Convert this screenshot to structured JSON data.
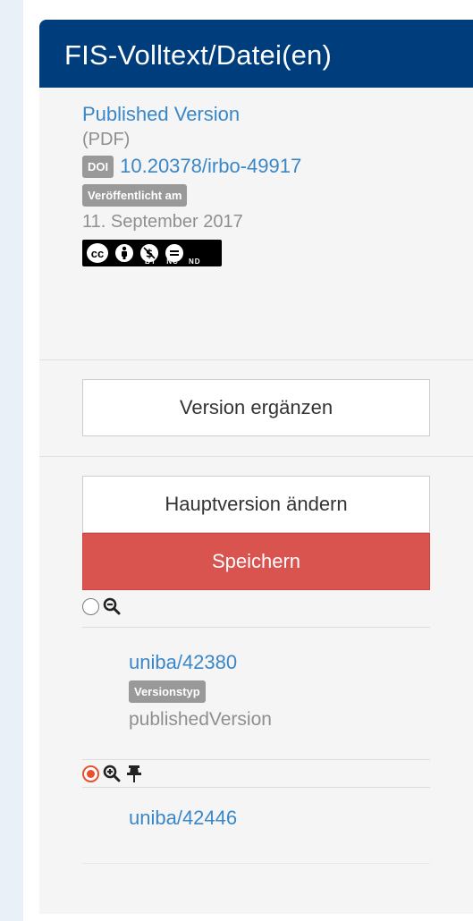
{
  "panel": {
    "title": "FIS-Volltext/Datei(en)"
  },
  "file": {
    "title": "Published Version",
    "format": "(PDF)",
    "doi_badge": "DOI",
    "doi": "10.20378/irbo-49917",
    "published_badge": "Veröffentlicht am",
    "published_date": "11. September 2017",
    "license_labels": "BY NC ND",
    "license_icon": "cc-by-nc-nd-icon"
  },
  "actions": {
    "add_version": "Version ergänzen",
    "change_main": "Hauptversion ändern",
    "save": "Speichern"
  },
  "versions": [
    {
      "id": "uniba/42380",
      "type_badge": "Versionstyp",
      "type": "publishedVersion",
      "selected": false
    },
    {
      "id": "uniba/42446",
      "selected": true,
      "pinned": true
    }
  ],
  "colors": {
    "header": "#003d7d",
    "link": "#3a87c8",
    "save": "#d9534f",
    "radio_checked": "#e8512b"
  }
}
